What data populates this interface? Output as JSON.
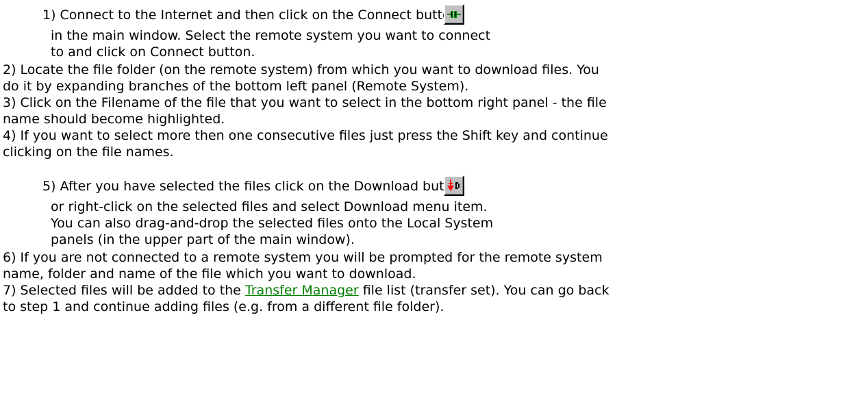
{
  "steps": {
    "s1": {
      "l1": "1) Connect to the Internet and then click on the Connect button",
      "l2": "in the main window. Select the remote system you want to connect",
      "l3": "to and click on Connect button."
    },
    "s2": {
      "l1": "2) Locate the file folder (on the remote system) from which you want to download files. You",
      "l2": "do it by expanding branches of the bottom left panel (Remote System)."
    },
    "s3": {
      "l1": "3) Click on the Filename of the file that you want to select in the bottom right panel - the file",
      "l2": "name should become highlighted."
    },
    "s4": {
      "l1": "4) If you want to select more then one consecutive files just press the Shift key and continue",
      "l2": "clicking on the file names."
    },
    "s5": {
      "l1": "5) After you have selected the files click on the Download button",
      "l2": "or right-click on the selected files and select Download menu item.",
      "l3": "You can also drag-and-drop the selected files onto the Local System",
      "l4": "panels (in the upper part of the main window)."
    },
    "s6": {
      "l1": "6) If you are not connected to a remote system you will be prompted for the remote system",
      "l2": "name, folder and name of the file which you want to download."
    },
    "s7": {
      "l1_before": "7) Selected files will be added to the ",
      "link": "Transfer Manager",
      "l1_after": " file list (transfer set). You can go back",
      "l2": "to step 1 and continue adding files (e.g. from a different file folder)."
    }
  },
  "icons": {
    "connect": "connect-plug-icon",
    "download": "download-arrow-icon"
  },
  "colors": {
    "link": "#008000",
    "icon_green": "#008000",
    "icon_red": "#ff0000",
    "button_face": "#c0c0c0"
  }
}
